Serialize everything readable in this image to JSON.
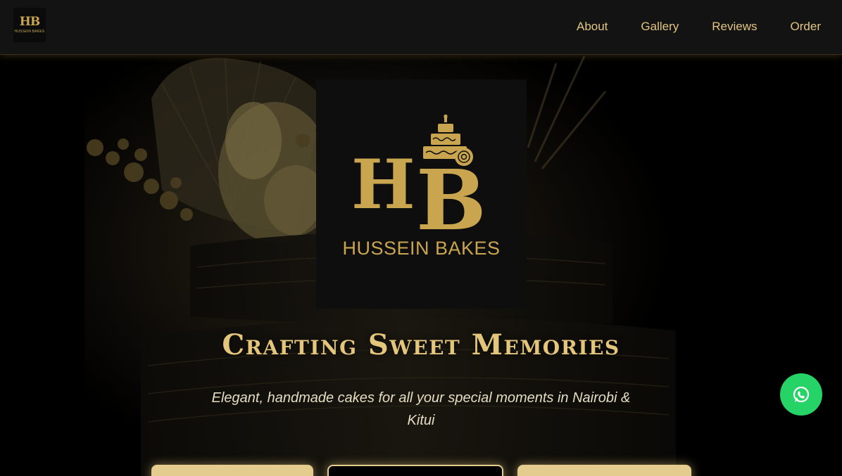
{
  "header": {
    "logo_monogram": "HB",
    "logo_caption": "HUSSEIN BAKES",
    "nav": [
      {
        "label": "About"
      },
      {
        "label": "Gallery"
      },
      {
        "label": "Reviews"
      },
      {
        "label": "Order"
      }
    ]
  },
  "hero": {
    "logo_monogram": "HB",
    "brand_name": "HUSSEIN BAKES",
    "title": "Crafting Sweet Memories",
    "subtitle": "Elegant, handmade cakes for all your special moments in Nairobi & Kitui"
  },
  "colors": {
    "gold": "#c9a54f",
    "gold_light": "#e3c57b",
    "header_bg": "#131313",
    "whatsapp_green": "#25d366"
  },
  "icons": {
    "whatsapp": "whatsapp-icon"
  }
}
